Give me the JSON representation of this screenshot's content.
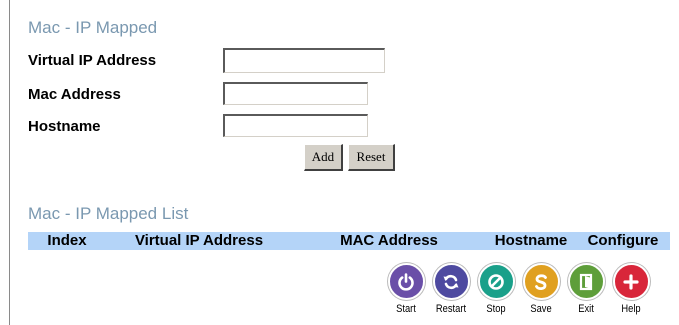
{
  "form": {
    "title": "Mac - IP Mapped",
    "virtual_ip_label": "Virtual IP Address",
    "virtual_ip_value": "",
    "mac_label": "Mac Address",
    "mac_value": "",
    "hostname_label": "Hostname",
    "hostname_value": "",
    "add_label": "Add",
    "reset_label": "Reset"
  },
  "list": {
    "title": "Mac - IP Mapped List",
    "columns": [
      "Index",
      "Virtual IP Address",
      "MAC Address",
      "Hostname",
      "Configure"
    ]
  },
  "toolbar": [
    {
      "label": "Start",
      "icon": "power-icon",
      "color": "#6a4fa8"
    },
    {
      "label": "Restart",
      "icon": "restart-icon",
      "color": "#4e4aa0"
    },
    {
      "label": "Stop",
      "icon": "stop-icon",
      "color": "#1aa08a"
    },
    {
      "label": "Save",
      "icon": "save-icon",
      "color": "#e0a020"
    },
    {
      "label": "Exit",
      "icon": "exit-icon",
      "color": "#5e9e3a"
    },
    {
      "label": "Help",
      "icon": "help-icon",
      "color": "#d8263a"
    }
  ]
}
